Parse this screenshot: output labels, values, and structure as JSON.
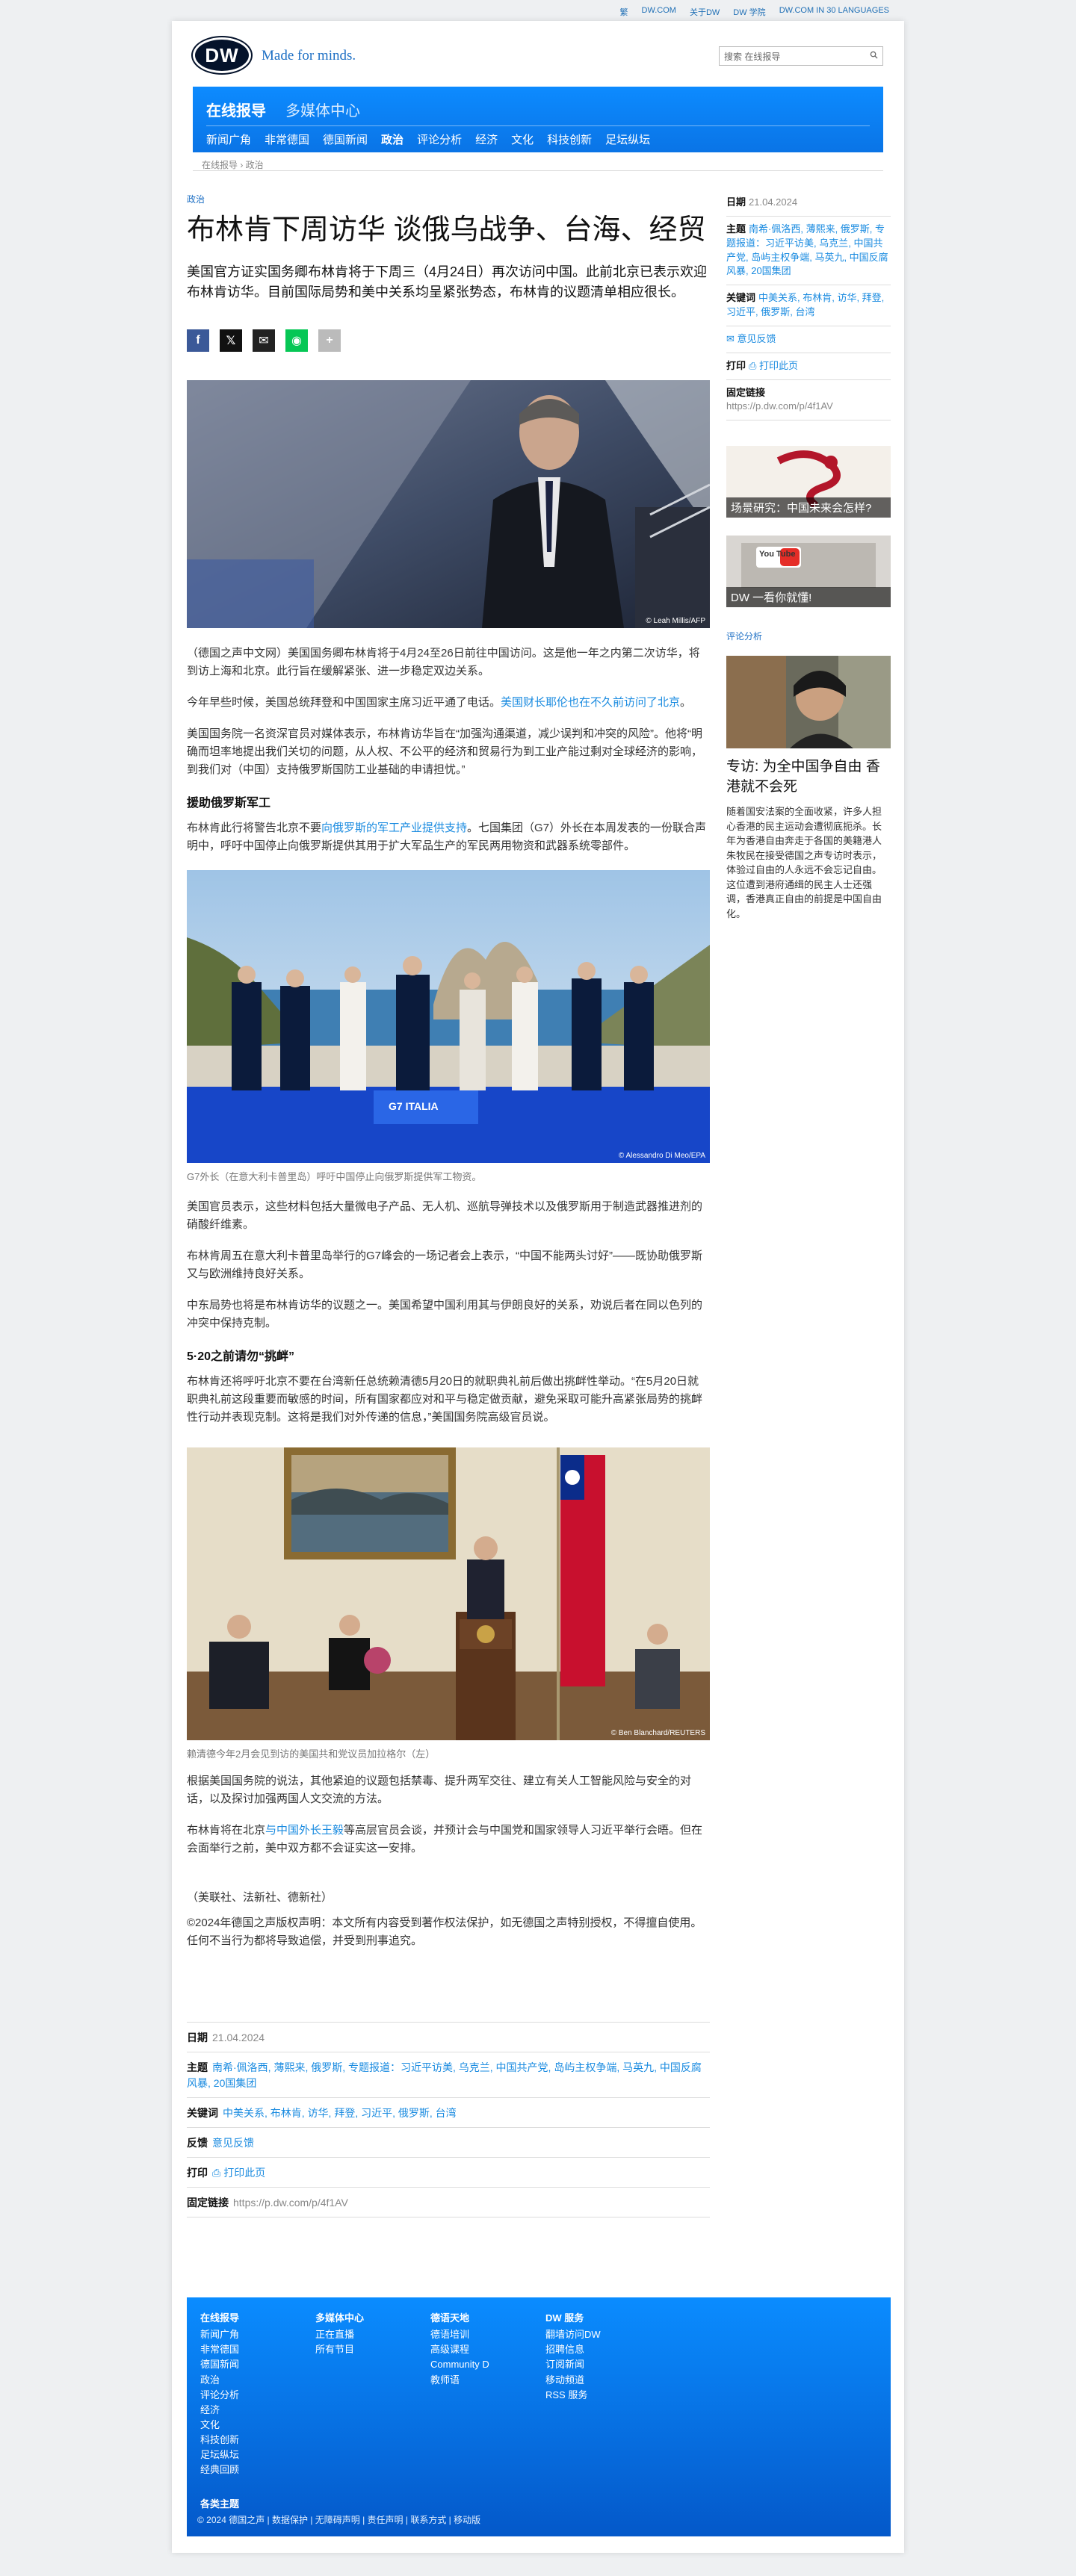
{
  "topbar": {
    "links": [
      "繁",
      "DW.COM",
      "关于DW",
      "DW 学院",
      "DW.COM IN 30 LANGUAGES"
    ]
  },
  "header": {
    "logo": "DW",
    "tagline": "Made for minds.",
    "search_placeholder": "搜索 在线报导"
  },
  "nav": {
    "title": "在线报导",
    "subtitle": "多媒体中心",
    "items": [
      "新闻广角",
      "非常德国",
      "德国新闻",
      "政治",
      "评论分析",
      "经济",
      "文化",
      "科技创新",
      "足坛纵坛"
    ]
  },
  "breadcrumb": "在线报导 › 政治",
  "article": {
    "kicker": "政治",
    "title": "布林肯下周访华 谈俄乌战争、台海、经贸",
    "lead": "美国官方证实国务卿布林肯将于下周三（4月24日）再次访问中国。此前北京已表示欢迎布林肯访华。目前国际局势和美中关系均呈紧张势态，布林肯的议题清单相应很长。",
    "img1_credit": "© Leah Millis/AFP",
    "p1": "（德国之声中文网）美国国务卿布林肯将于4月24至26日前往中国访问。这是他一年之内第二次访华，将到访上海和北京。此行旨在缓解紧张、进一步稳定双边关系。",
    "p2_a": "今年早些时候，美国总统拜登和中国国家主席习近平通了电话。",
    "p2_link": "美国财长耶伦也在不久前访问了北京",
    "p2_b": "。",
    "p3": "美国国务院一名资深官员对媒体表示，布林肯访华旨在“加强沟通渠道，减少误判和冲突的风险”。他将“明确而坦率地提出我们关切的问题，从人权、不公平的经济和贸易行为到工业产能过剩对全球经济的影响，到我们对（中国）支持俄罗斯国防工业基础的申请担忧。”",
    "h1": "援助俄罗斯军工",
    "p4_a": "布林肯此行将警告北京不要",
    "p4_link": "向俄罗斯的军工产业提供支持",
    "p4_b": "。七国集团（G7）外长在本周发表的一份联合声明中，呼吁中国停止向俄罗斯提供其用于扩大军品生产的军民两用物资和武器系统零部件。",
    "img2_credit": "© Alessandro Di Meo/EPA",
    "img2_banner": "G7 ITALIA",
    "caption2": "G7外长（在意大利卡普里岛）呼吁中国停止向俄罗斯提供军工物资。",
    "p5": "美国官员表示，这些材料包括大量微电子产品、无人机、巡航导弹技术以及俄罗斯用于制造武器推进剂的硝酸纤维素。",
    "p6": "布林肯周五在意大利卡普里岛举行的G7峰会的一场记者会上表示，“中国不能两头讨好”——既协助俄罗斯又与欧洲维持良好关系。",
    "p7": "中东局势也将是布林肯访华的议题之一。美国希望中国利用其与伊朗良好的关系，劝说后者在同以色列的冲突中保持克制。",
    "h2": "5·20之前请勿“挑衅”",
    "p8": "布林肯还将呼吁北京不要在台湾新任总统赖清德5月20日的就职典礼前后做出挑衅性举动。“在5月20日就职典礼前这段重要而敏感的时间，所有国家都应对和平与稳定做贡献，避免采取可能升高紧张局势的挑衅性行动并表现克制。这将是我们对外传递的信息，”美国国务院高级官员说。",
    "img3_credit": "© Ben Blanchard/REUTERS",
    "caption3": "赖清德今年2月会见到访的美国共和党议员加拉格尔（左）",
    "p9": "根据美国国务院的说法，其他紧迫的议题包括禁毒、提升两军交往、建立有关人工智能风险与安全的对话，以及探讨加强两国人文交流的方法。",
    "p10_a": "布林肯将在北京",
    "p10_link": "与中国外长王毅",
    "p10_b": "等高层官员会谈，并预计会与中国党和国家领导人习近平举行会晤。但在会面举行之前，美中双方都不会证实这一安排。",
    "sources": "（美联社、法新社、德新社）",
    "copyright": "©2024年德国之声版权声明：本文所有内容受到著作权法保护，如无德国之声特别授权，不得擅自使用。任何不当行为都将导致追偿，并受到刑事追究。"
  },
  "meta": {
    "date_label": "日期",
    "date": "21.04.2024",
    "topics_label": "主题",
    "topics": "南希·佩洛西, 薄熙来, 俄罗斯, 专题报道：习近平访美, 乌克兰, 中国共产党, 岛屿主权争端, 马英九, 中国反腐风暴, 20国集团",
    "keywords_label": "关键词",
    "keywords": "中美关系, 布林肯, 访华, 拜登, 习近平, 俄罗斯, 台湾",
    "feedback_label": "反馈",
    "feedback": "意见反馈",
    "print_label": "打印",
    "print": "打印此页",
    "permalink_label": "固定链接",
    "permalink": "https://p.dw.com/p/4f1AV"
  },
  "sidebar": {
    "teaser1": "场景研究：中国未来会怎样?",
    "teaser2": "DW 一看你就懂!",
    "teaser2_logo": "You Tube",
    "section": "评论分析",
    "story_title": "专访: 为全中国争自由 香港就不会死",
    "story_text": "随着国安法案的全面收紧，许多人担心香港的民主运动会遭彻底扼杀。长年为香港自由奔走于各国的美籍港人朱牧民在接受德国之声专访时表示，体验过自由的人永远不会忘记自由。这位遭到港府通缉的民主人士还强调，香港真正自由的前提是中国自由化。"
  },
  "footer": {
    "col1_title": "在线报导",
    "col1": [
      "新闻广角",
      "非常德国",
      "德国新闻",
      "政治",
      "评论分析",
      "经济",
      "文化",
      "科技创新",
      "足坛纵坛",
      "经典回顾"
    ],
    "col2_title": "多媒体中心",
    "col2": [
      "正在直播",
      "所有节目"
    ],
    "col3_title": "德语天地",
    "col3": [
      "德语培训",
      "高级课程",
      "Community D",
      "教师语"
    ],
    "col4_title": "DW 服务",
    "col4": [
      "翻墙访问DW",
      "招聘信息",
      "订阅新闻",
      "移动频道",
      "RSS 服务"
    ],
    "topics": "各类主题",
    "bottom": "© 2024 德国之声 | 数据保护 | 无障碍声明 | 责任声明 | 联系方式 | 移动版"
  }
}
